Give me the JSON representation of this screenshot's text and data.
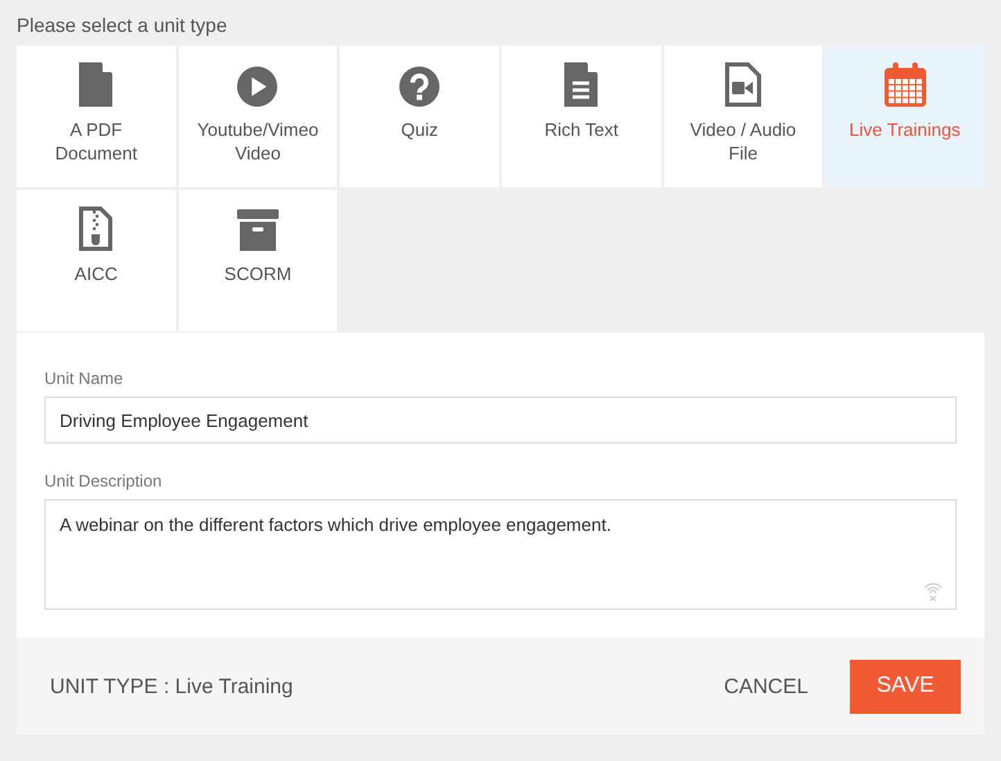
{
  "heading": "Please select a unit type",
  "unit_types": [
    {
      "label": "A PDF Document",
      "kind": "pdf",
      "selected": false
    },
    {
      "label": "Youtube/Vimeo Video",
      "kind": "play",
      "selected": false
    },
    {
      "label": "Quiz",
      "kind": "quiz",
      "selected": false
    },
    {
      "label": "Rich Text",
      "kind": "richtext",
      "selected": false
    },
    {
      "label": "Video / Audio File",
      "kind": "video",
      "selected": false
    },
    {
      "label": "Live Trainings",
      "kind": "calendar",
      "selected": true
    },
    {
      "label": "AICC",
      "kind": "zip",
      "selected": false
    },
    {
      "label": "SCORM",
      "kind": "archive",
      "selected": false
    }
  ],
  "form": {
    "name_label": "Unit Name",
    "name_value": "Driving Employee Engagement",
    "description_label": "Unit Description",
    "description_value": "A webinar on the different factors which drive employee engagement."
  },
  "footer": {
    "unit_type": "UNIT TYPE : Live Training",
    "buttons": [
      "CANCEL",
      "SAVE"
    ]
  }
}
